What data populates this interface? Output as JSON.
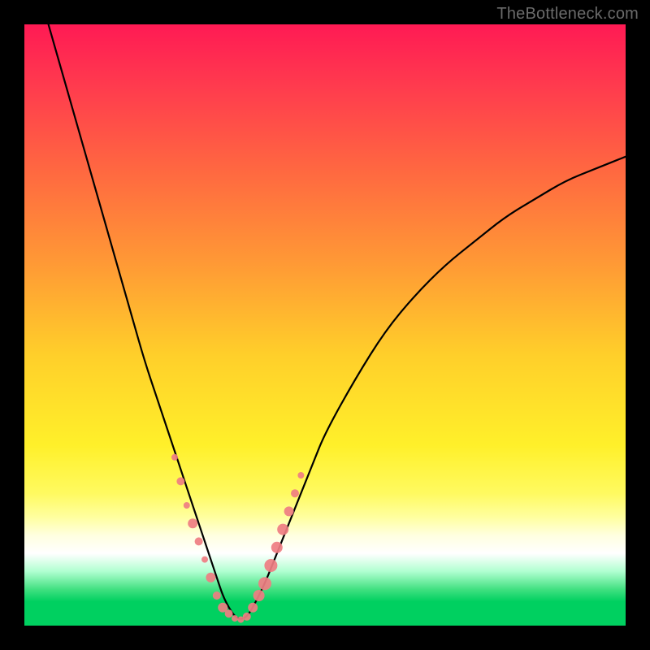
{
  "watermark": {
    "text": "TheBottleneck.com"
  },
  "colors": {
    "background": "#000000",
    "curve": "#000000",
    "marker": "#ef7d82",
    "gradient_stops": [
      "#ff1a54",
      "#ff3a4e",
      "#ff6a40",
      "#ff9a35",
      "#ffcf2a",
      "#fff02a",
      "#fffa60",
      "#ffffa0",
      "#ffffe0",
      "#ffffff",
      "#b0ffd0",
      "#40e080",
      "#00d060"
    ]
  },
  "chart_data": {
    "type": "line",
    "title": "",
    "xlabel": "",
    "ylabel": "",
    "xlim": [
      0,
      100
    ],
    "ylim": [
      0,
      100
    ],
    "grid": false,
    "legend": false,
    "series": [
      {
        "name": "bottleneck-curve",
        "x": [
          4,
          6,
          8,
          10,
          12,
          14,
          16,
          18,
          20,
          22,
          24,
          26,
          28,
          29,
          30,
          31,
          32,
          33,
          34,
          35,
          36,
          37,
          38,
          40,
          42,
          44,
          46,
          48,
          50,
          55,
          60,
          65,
          70,
          75,
          80,
          85,
          90,
          95,
          100
        ],
        "values": [
          100,
          93,
          86,
          79,
          72,
          65,
          58,
          51,
          44,
          38,
          32,
          26,
          20,
          17,
          14,
          11,
          8,
          5,
          3,
          1.5,
          1,
          1.5,
          3,
          7,
          12,
          17,
          22,
          27,
          32,
          41,
          49,
          55,
          60,
          64,
          68,
          71,
          74,
          76,
          78
        ]
      }
    ],
    "markers": [
      {
        "name": "highlighted-points",
        "x": [
          25,
          26,
          27,
          28,
          29,
          30,
          31,
          32,
          33,
          34,
          35,
          36,
          37,
          38,
          39,
          40,
          41,
          42,
          43,
          44,
          45,
          46
        ],
        "values": [
          28,
          24,
          20,
          17,
          14,
          11,
          8,
          5,
          3,
          2,
          1.2,
          1,
          1.5,
          3,
          5,
          7,
          10,
          13,
          16,
          19,
          22,
          25
        ],
        "radius": [
          4,
          5,
          4,
          6,
          5,
          4,
          6,
          5,
          6,
          5,
          4,
          4,
          5,
          6,
          7,
          8,
          8,
          7,
          7,
          6,
          5,
          4
        ]
      }
    ]
  }
}
